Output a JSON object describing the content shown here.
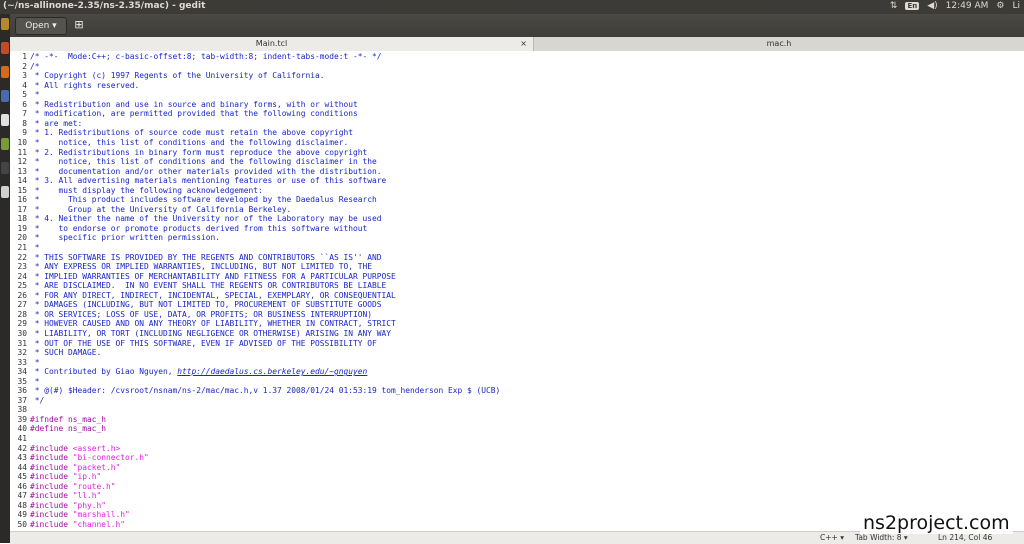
{
  "window": {
    "title": "(~/ns-allinone-2.35/ns-2.35/mac) - gedit"
  },
  "tray": {
    "keyboard": "En",
    "time": "12:49 AM",
    "user": "Li"
  },
  "toolbar": {
    "open_label": "Open ▾",
    "save_icon": "save-icon"
  },
  "tabs": [
    {
      "label": "Main.tcl",
      "close": "×"
    },
    {
      "label": "mac.h"
    }
  ],
  "statusbar": {
    "language": "C++ ▾",
    "tab_width": "Tab Width: 8 ▾",
    "position": "Ln 214, Col 46"
  },
  "watermark": "ns2project.com",
  "lines": [
    {
      "n": "1",
      "t": "/* -*-  Mode:C++; c-basic-offset:8; tab-width:8; indent-tabs-mode:t -*- */",
      "k": "comment"
    },
    {
      "n": "2",
      "t": "/*",
      "k": "comment"
    },
    {
      "n": "3",
      "t": " * Copyright (c) 1997 Regents of the University of California.",
      "k": "comment"
    },
    {
      "n": "4",
      "t": " * All rights reserved.",
      "k": "comment"
    },
    {
      "n": "5",
      "t": " *",
      "k": "comment"
    },
    {
      "n": "6",
      "t": " * Redistribution and use in source and binary forms, with or without",
      "k": "comment"
    },
    {
      "n": "7",
      "t": " * modification, are permitted provided that the following conditions",
      "k": "comment"
    },
    {
      "n": "8",
      "t": " * are met:",
      "k": "comment"
    },
    {
      "n": "9",
      "t": " * 1. Redistributions of source code must retain the above copyright",
      "k": "comment"
    },
    {
      "n": "10",
      "t": " *    notice, this list of conditions and the following disclaimer.",
      "k": "comment"
    },
    {
      "n": "11",
      "t": " * 2. Redistributions in binary form must reproduce the above copyright",
      "k": "comment"
    },
    {
      "n": "12",
      "t": " *    notice, this list of conditions and the following disclaimer in the",
      "k": "comment"
    },
    {
      "n": "13",
      "t": " *    documentation and/or other materials provided with the distribution.",
      "k": "comment"
    },
    {
      "n": "14",
      "t": " * 3. All advertising materials mentioning features or use of this software",
      "k": "comment"
    },
    {
      "n": "15",
      "t": " *    must display the following acknowledgement:",
      "k": "comment"
    },
    {
      "n": "16",
      "t": " *      This product includes software developed by the Daedalus Research",
      "k": "comment"
    },
    {
      "n": "17",
      "t": " *      Group at the University of California Berkeley.",
      "k": "comment"
    },
    {
      "n": "18",
      "t": " * 4. Neither the name of the University nor of the Laboratory may be used",
      "k": "comment"
    },
    {
      "n": "19",
      "t": " *    to endorse or promote products derived from this software without",
      "k": "comment"
    },
    {
      "n": "20",
      "t": " *    specific prior written permission.",
      "k": "comment"
    },
    {
      "n": "21",
      "t": " *",
      "k": "comment"
    },
    {
      "n": "22",
      "t": " * THIS SOFTWARE IS PROVIDED BY THE REGENTS AND CONTRIBUTORS ``AS IS'' AND",
      "k": "comment"
    },
    {
      "n": "23",
      "t": " * ANY EXPRESS OR IMPLIED WARRANTIES, INCLUDING, BUT NOT LIMITED TO, THE",
      "k": "comment"
    },
    {
      "n": "24",
      "t": " * IMPLIED WARRANTIES OF MERCHANTABILITY AND FITNESS FOR A PARTICULAR PURPOSE",
      "k": "comment"
    },
    {
      "n": "25",
      "t": " * ARE DISCLAIMED.  IN NO EVENT SHALL THE REGENTS OR CONTRIBUTORS BE LIABLE",
      "k": "comment"
    },
    {
      "n": "26",
      "t": " * FOR ANY DIRECT, INDIRECT, INCIDENTAL, SPECIAL, EXEMPLARY, OR CONSEQUENTIAL",
      "k": "comment"
    },
    {
      "n": "27",
      "t": " * DAMAGES (INCLUDING, BUT NOT LIMITED TO, PROCUREMENT OF SUBSTITUTE GOODS",
      "k": "comment"
    },
    {
      "n": "28",
      "t": " * OR SERVICES; LOSS OF USE, DATA, OR PROFITS; OR BUSINESS INTERRUPTION)",
      "k": "comment"
    },
    {
      "n": "29",
      "t": " * HOWEVER CAUSED AND ON ANY THEORY OF LIABILITY, WHETHER IN CONTRACT, STRICT",
      "k": "comment"
    },
    {
      "n": "30",
      "t": " * LIABILITY, OR TORT (INCLUDING NEGLIGENCE OR OTHERWISE) ARISING IN ANY WAY",
      "k": "comment"
    },
    {
      "n": "31",
      "t": " * OUT OF THE USE OF THIS SOFTWARE, EVEN IF ADVISED OF THE POSSIBILITY OF",
      "k": "comment"
    },
    {
      "n": "32",
      "t": " * SUCH DAMAGE.",
      "k": "comment"
    },
    {
      "n": "33",
      "t": " *",
      "k": "comment"
    },
    {
      "n": "34",
      "t": " * Contributed by Giao Nguyen, ",
      "k": "comment",
      "link": "http://daedalus.cs.berkeley.edu/~gnguyen"
    },
    {
      "n": "35",
      "t": " *",
      "k": "comment"
    },
    {
      "n": "36",
      "t": " * @(#) $Header: /cvsroot/nsnam/ns-2/mac/mac.h,v 1.37 2008/01/24 01:53:19 tom_henderson Exp $ (UCB)",
      "k": "comment"
    },
    {
      "n": "37",
      "t": " */",
      "k": "comment"
    },
    {
      "n": "38",
      "t": "",
      "k": "plain"
    },
    {
      "n": "39",
      "t": "#ifndef ns_mac_h",
      "k": "pre"
    },
    {
      "n": "40",
      "t": "#define ns_mac_h",
      "k": "pre"
    },
    {
      "n": "41",
      "t": "",
      "k": "plain"
    },
    {
      "n": "42",
      "t": "#include ",
      "k": "pre",
      "s": "<assert.h>"
    },
    {
      "n": "43",
      "t": "#include ",
      "k": "pre",
      "s": "\"bi-connector.h\""
    },
    {
      "n": "44",
      "t": "#include ",
      "k": "pre",
      "s": "\"packet.h\""
    },
    {
      "n": "45",
      "t": "#include ",
      "k": "pre",
      "s": "\"ip.h\""
    },
    {
      "n": "46",
      "t": "#include ",
      "k": "pre",
      "s": "\"route.h\""
    },
    {
      "n": "47",
      "t": "#include ",
      "k": "pre",
      "s": "\"ll.h\""
    },
    {
      "n": "48",
      "t": "#include ",
      "k": "pre",
      "s": "\"phy.h\""
    },
    {
      "n": "49",
      "t": "#include ",
      "k": "pre",
      "s": "\"marshall.h\""
    },
    {
      "n": "50",
      "t": "#include ",
      "k": "pre",
      "s": "\"channel.h\""
    }
  ]
}
